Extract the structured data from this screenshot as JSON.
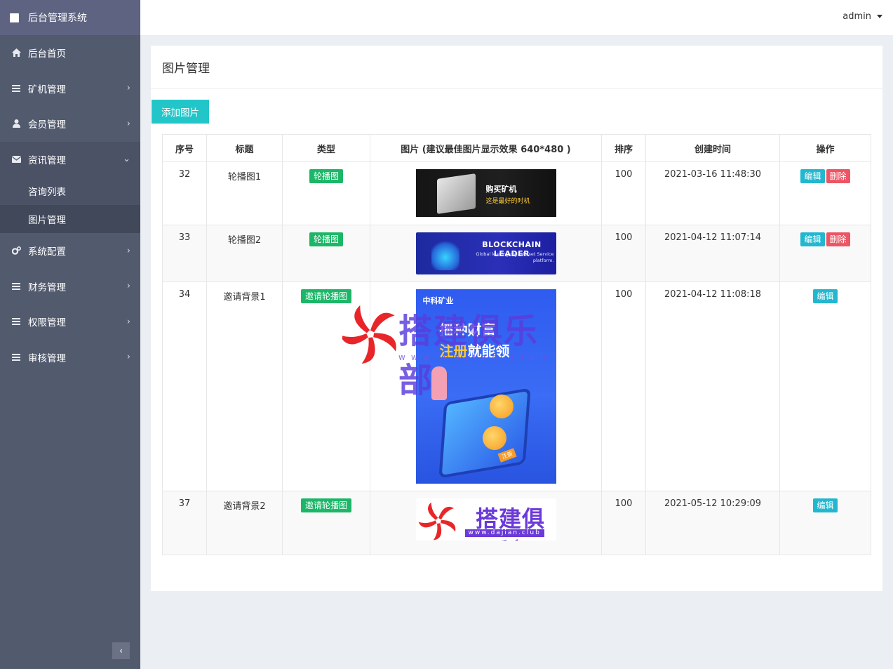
{
  "app": {
    "title": "后台管理系统"
  },
  "header": {
    "user": "admin"
  },
  "sidebar": {
    "items": [
      {
        "label": "后台首页",
        "icon": "home-icon"
      },
      {
        "label": "矿机管理",
        "icon": "list-icon"
      },
      {
        "label": "会员管理",
        "icon": "user-icon"
      },
      {
        "label": "资讯管理",
        "icon": "envelope-icon",
        "open": true,
        "children": [
          {
            "label": "咨询列表"
          },
          {
            "label": "图片管理",
            "active": true
          }
        ]
      },
      {
        "label": "系统配置",
        "icon": "gears-icon"
      },
      {
        "label": "财务管理",
        "icon": "list-icon"
      },
      {
        "label": "权限管理",
        "icon": "list-icon"
      },
      {
        "label": "审核管理",
        "icon": "list-icon"
      }
    ]
  },
  "panel": {
    "title": "图片管理",
    "add_button": "添加图片"
  },
  "table": {
    "headers": [
      "序号",
      "标题",
      "类型",
      "图片 (建议最佳图片显示效果 640*480 )",
      "排序",
      "创建时间",
      "操作"
    ],
    "rows": [
      {
        "id": "32",
        "title": "轮播图1",
        "type": "轮播图",
        "sort": "100",
        "created": "2021-03-16 11:48:30",
        "actions": [
          "编辑",
          "删除"
        ],
        "image": {
          "line1": "购买矿机",
          "line2": "这是最好的时机"
        }
      },
      {
        "id": "33",
        "title": "轮播图2",
        "type": "轮播图",
        "sort": "100",
        "created": "2021-04-12 11:07:14",
        "actions": [
          "编辑",
          "删除"
        ],
        "image": {
          "line1": "BLOCKCHAIN LEADER",
          "line2": "Global leading digital aset Service",
          "line3": "platform."
        }
      },
      {
        "id": "34",
        "title": "邀请背景1",
        "type": "邀请轮播图",
        "sort": "100",
        "created": "2021-04-12 11:08:18",
        "actions": [
          "编辑"
        ],
        "image": {
          "brand": "中科矿业",
          "head1": "播种财富",
          "head2_hl": "注册",
          "head2": "就能领",
          "cta": "注册"
        }
      },
      {
        "id": "37",
        "title": "邀请背景2",
        "type": "邀请轮播图",
        "sort": "100",
        "created": "2021-05-12 10:29:09",
        "actions": [
          "编辑"
        ],
        "image": {
          "logo_text": "搭建俱乐部",
          "logo_url": "www.dajian.club"
        }
      }
    ]
  },
  "watermark": {
    "text": "搭建俱乐部",
    "url": "www.dajian.club"
  },
  "colors": {
    "sidebar_bg": "#525a6e",
    "brand_bg": "#5d6380",
    "accent": "#23c6c8",
    "badge": "#1cb668",
    "edit": "#23b7cf",
    "delete": "#ed5565"
  }
}
